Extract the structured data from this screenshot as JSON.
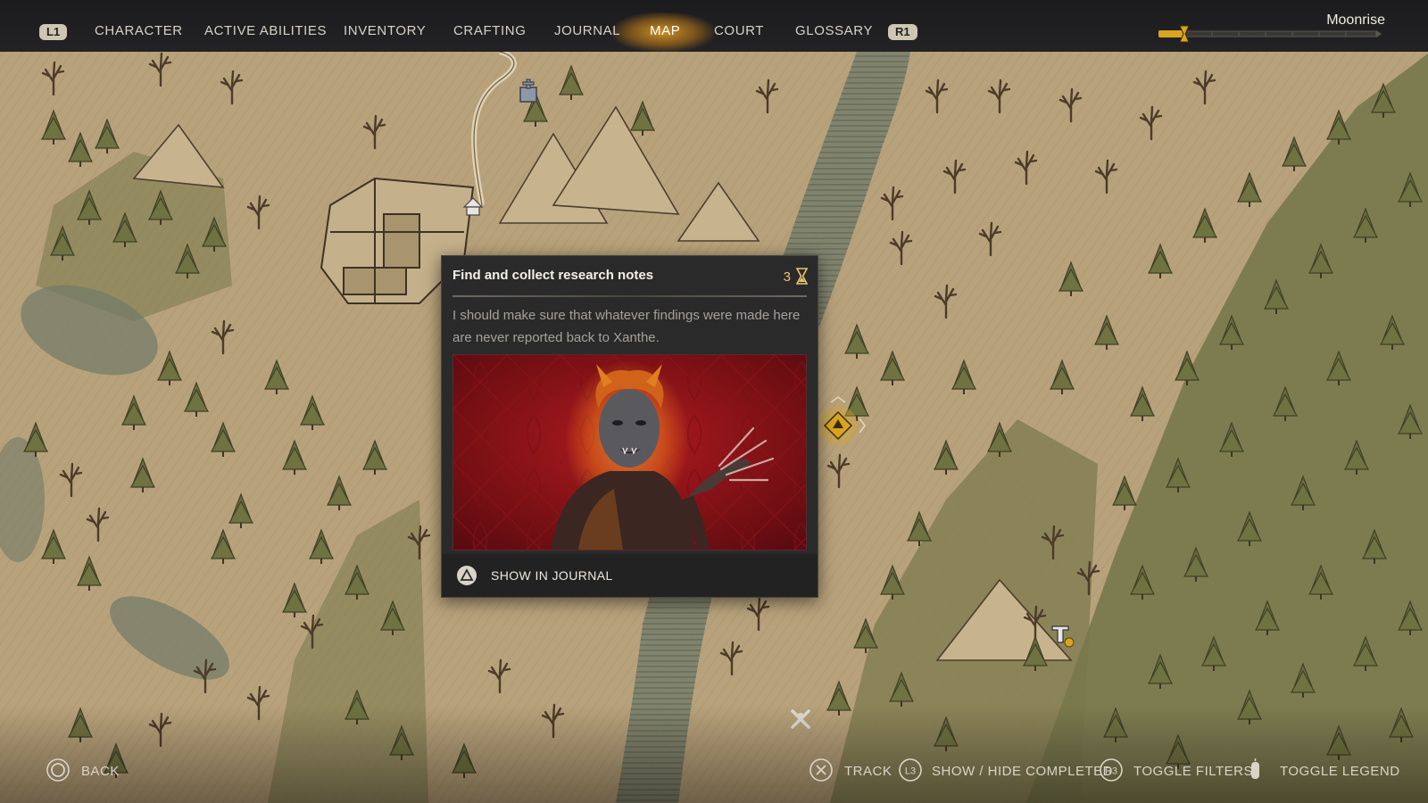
{
  "nav": {
    "left_button": "L1",
    "right_button": "R1",
    "tabs": [
      {
        "label": "CHARACTER"
      },
      {
        "label": "ACTIVE ABILITIES"
      },
      {
        "label": "INVENTORY"
      },
      {
        "label": "CRAFTING"
      },
      {
        "label": "JOURNAL"
      },
      {
        "label": "MAP",
        "active": true
      },
      {
        "label": "COURT"
      },
      {
        "label": "GLOSSARY"
      }
    ],
    "accent_color": "#d9a521"
  },
  "time_of_day": {
    "label": "Moonrise",
    "icon": "moon-icon",
    "progress": 0.12
  },
  "quest_card": {
    "title": "Find and collect research notes",
    "count": "3",
    "count_icon": "hourglass-icon",
    "description": "I should make sure that whatever findings were made here are never reported back to Xanthe.",
    "image": "portrait of a red-skinned vampire woman against a crimson patterned background",
    "action": {
      "button_icon": "triangle-button-icon",
      "label": "SHOW IN JOURNAL"
    }
  },
  "map": {
    "markers": [
      {
        "icon": "grave-marker-icon"
      },
      {
        "icon": "house-marker-icon"
      },
      {
        "icon": "quest-marker-icon",
        "color": "#d9a521"
      },
      {
        "icon": "crafting-marker-icon"
      },
      {
        "icon": "crossed-bones-marker-icon"
      }
    ]
  },
  "hints": {
    "back": {
      "icon": "circle-button-icon",
      "label": "BACK"
    },
    "track": {
      "icon": "cross-button-icon",
      "label": "TRACK"
    },
    "completed": {
      "icon": "l3-button-icon",
      "label": "SHOW / HIDE COMPLETED"
    },
    "filters": {
      "icon": "r3-button-icon",
      "label": "TOGGLE FILTERS"
    },
    "legend": {
      "icon": "touchpad-icon",
      "label": "TOGGLE LEGEND"
    }
  }
}
